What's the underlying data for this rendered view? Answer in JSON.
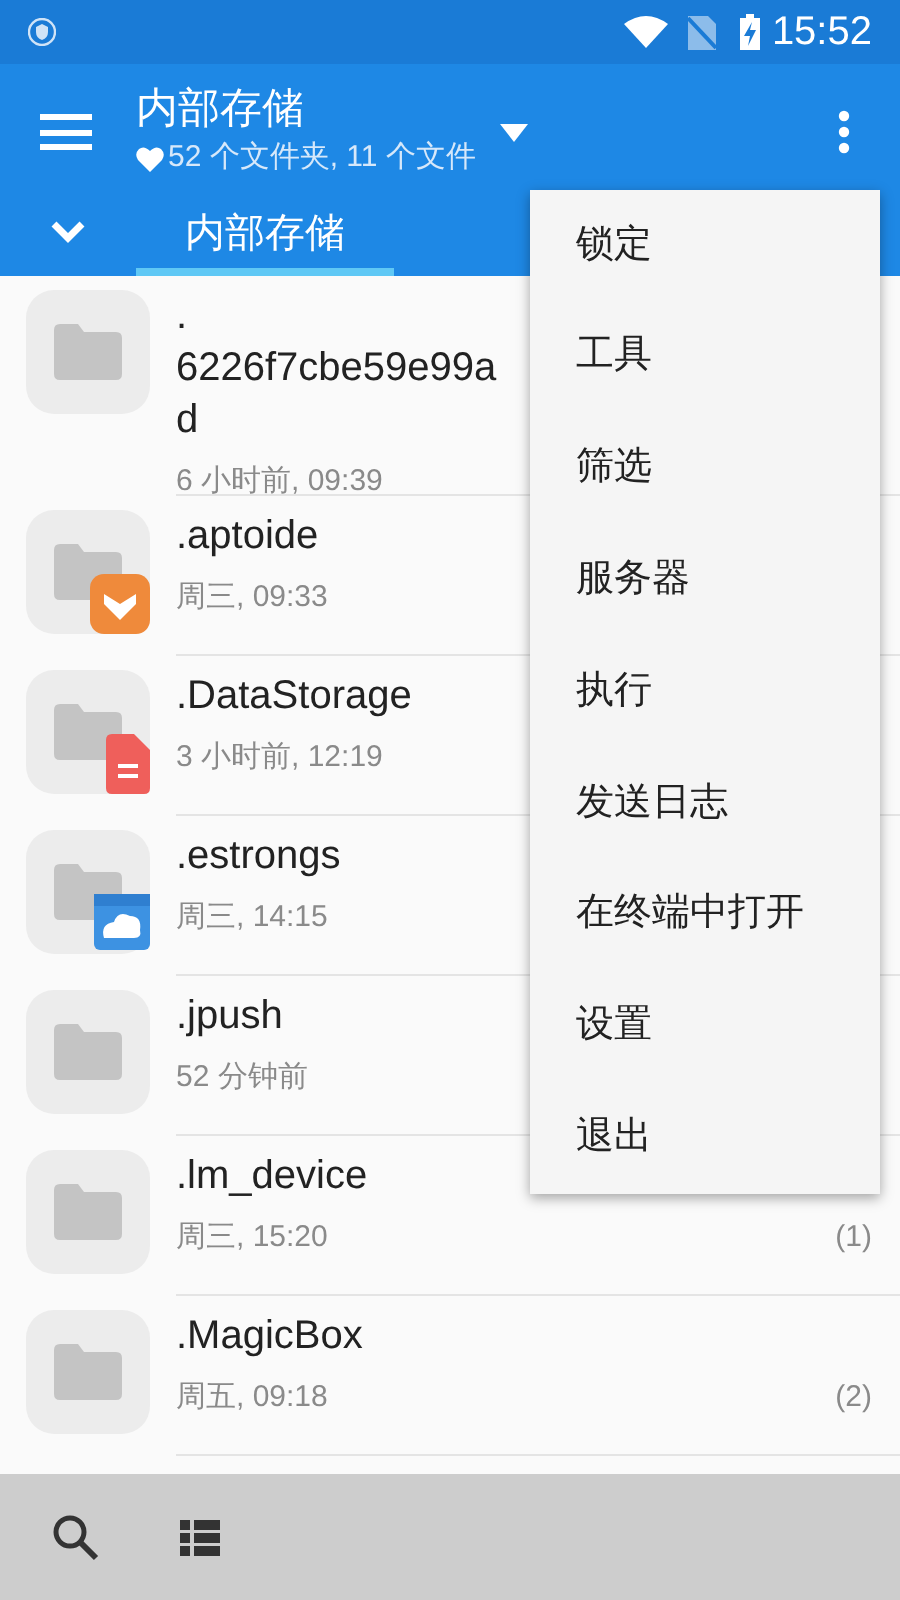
{
  "status_bar": {
    "time": "15:52"
  },
  "toolbar": {
    "title": "内部存储",
    "subtitle": "52 个文件夹, 11 个文件"
  },
  "tabs": [
    {
      "label": "内部存储",
      "selected": true
    }
  ],
  "files": [
    {
      "name_lines": [
        ".",
        "6226f7cbe59e99a",
        "d"
      ],
      "meta": "6 小时前, 09:39"
    },
    {
      "name_lines": [
        ".aptoide"
      ],
      "meta": "周三, 09:33",
      "kind": "shield"
    },
    {
      "name_lines": [
        ".DataStorage"
      ],
      "meta": "3 小时前, 12:19",
      "kind": "document"
    },
    {
      "name_lines": [
        ".estrongs"
      ],
      "meta": "周三, 14:15",
      "kind": "cloud"
    },
    {
      "name_lines": [
        ".jpush"
      ],
      "meta": "52 分钟前"
    },
    {
      "name_lines": [
        ".lm_device"
      ],
      "meta": "周三, 15:20",
      "count": "(1)"
    },
    {
      "name_lines": [
        ".MagicBox"
      ],
      "meta": "周五, 09:18",
      "count": "(2)"
    }
  ],
  "menu": [
    "锁定",
    "工具",
    "筛选",
    "服务器",
    "执行",
    "发送日志",
    "在终端中打开",
    "设置",
    "退出"
  ]
}
